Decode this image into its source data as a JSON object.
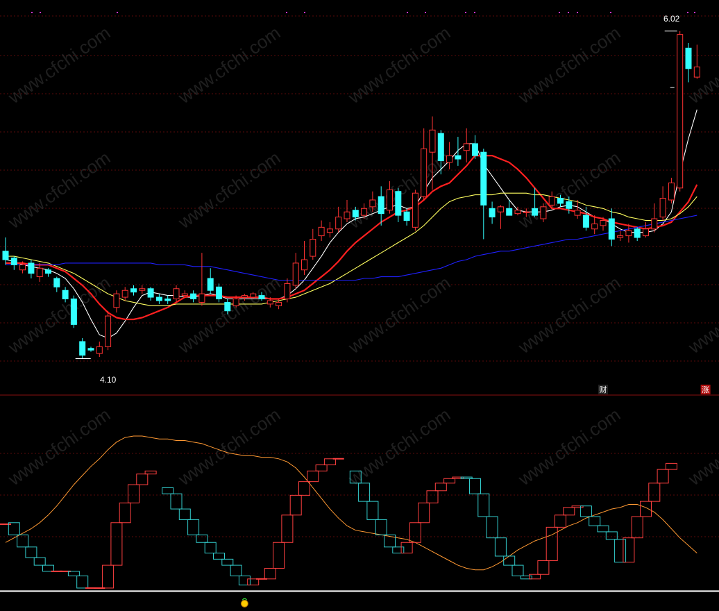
{
  "chart_data": [
    {
      "type": "candlestick",
      "name": "main",
      "price_labels": {
        "high": "6.02",
        "low": "4.10"
      },
      "ylim": [
        3.98,
        6.08
      ],
      "ohlc": [
        [
          4.73,
          4.68,
          4.81,
          4.65
        ],
        [
          4.69,
          4.65,
          4.7,
          4.62
        ],
        [
          4.62,
          4.65,
          4.67,
          4.6
        ],
        [
          4.66,
          4.6,
          4.68,
          4.57
        ],
        [
          4.58,
          4.63,
          4.66,
          4.55
        ],
        [
          4.62,
          4.6,
          4.63,
          4.58
        ],
        [
          4.57,
          4.52,
          4.58,
          4.49
        ],
        [
          4.5,
          4.45,
          4.52,
          4.43
        ],
        [
          4.45,
          4.3,
          4.47,
          4.28
        ],
        [
          4.2,
          4.12,
          4.22,
          4.1
        ],
        [
          4.16,
          4.15,
          4.17,
          4.14
        ],
        [
          4.13,
          4.17,
          4.2,
          4.11
        ],
        [
          4.17,
          4.35,
          4.38,
          4.15
        ],
        [
          4.4,
          4.48,
          4.5,
          4.37
        ],
        [
          4.46,
          4.5,
          4.52,
          4.44
        ],
        [
          4.51,
          4.49,
          4.53,
          4.47
        ],
        [
          4.5,
          4.51,
          4.53,
          4.48
        ],
        [
          4.51,
          4.46,
          4.52,
          4.44
        ],
        [
          4.46,
          4.44,
          4.48,
          4.42
        ],
        [
          4.45,
          4.44,
          4.47,
          4.42
        ],
        [
          4.45,
          4.51,
          4.53,
          4.43
        ],
        [
          4.47,
          4.48,
          4.5,
          4.46
        ],
        [
          4.48,
          4.45,
          4.5,
          4.43
        ],
        [
          4.43,
          4.48,
          4.72,
          4.41
        ],
        [
          4.57,
          4.5,
          4.63,
          4.48
        ],
        [
          4.52,
          4.45,
          4.54,
          4.43
        ],
        [
          4.43,
          4.38,
          4.45,
          4.36
        ],
        [
          4.41,
          4.45,
          4.47,
          4.4
        ],
        [
          4.46,
          4.47,
          4.48,
          4.44
        ],
        [
          4.46,
          4.48,
          4.49,
          4.45
        ],
        [
          4.47,
          4.45,
          4.49,
          4.44
        ],
        [
          4.42,
          4.44,
          4.46,
          4.4
        ],
        [
          4.41,
          4.43,
          4.45,
          4.39
        ],
        [
          4.45,
          4.54,
          4.57,
          4.43
        ],
        [
          4.53,
          4.66,
          4.72,
          4.51
        ],
        [
          4.62,
          4.68,
          4.79,
          4.59
        ],
        [
          4.7,
          4.8,
          4.86,
          4.68
        ],
        [
          4.82,
          4.87,
          4.91,
          4.79
        ],
        [
          4.84,
          4.86,
          4.9,
          4.81
        ],
        [
          4.86,
          4.93,
          4.99,
          4.84
        ],
        [
          4.92,
          4.96,
          5.03,
          4.9
        ],
        [
          4.97,
          4.93,
          4.99,
          4.91
        ],
        [
          4.94,
          4.98,
          5.01,
          4.92
        ],
        [
          4.99,
          5.03,
          5.08,
          4.96
        ],
        [
          5.05,
          4.95,
          5.11,
          4.88
        ],
        [
          4.97,
          5.09,
          5.14,
          4.95
        ],
        [
          5.08,
          4.94,
          5.1,
          4.9
        ],
        [
          4.96,
          4.91,
          4.98,
          4.88
        ],
        [
          4.87,
          5.07,
          5.09,
          4.85
        ],
        [
          5.05,
          5.33,
          5.45,
          5.03
        ],
        [
          5.31,
          5.44,
          5.52,
          5.09
        ],
        [
          5.42,
          5.26,
          5.44,
          5.18
        ],
        [
          5.25,
          5.29,
          5.37,
          5.21
        ],
        [
          5.29,
          5.27,
          5.4,
          5.23
        ],
        [
          5.32,
          5.36,
          5.45,
          5.25
        ],
        [
          5.36,
          5.29,
          5.41,
          5.27
        ],
        [
          5.31,
          5.0,
          5.33,
          4.8
        ],
        [
          4.98,
          4.93,
          5.02,
          4.89
        ],
        [
          4.96,
          4.99,
          5.0,
          4.86
        ],
        [
          4.98,
          4.94,
          5.03,
          4.94
        ],
        [
          4.95,
          4.97,
          4.99,
          4.94
        ],
        [
          4.96,
          4.96,
          4.98,
          4.93
        ],
        [
          4.98,
          4.94,
          5.1,
          4.93
        ],
        [
          4.92,
          4.99,
          5.01,
          4.9
        ],
        [
          5.0,
          5.05,
          5.08,
          4.98
        ],
        [
          5.04,
          5.01,
          5.06,
          4.99
        ],
        [
          5.02,
          4.98,
          5.05,
          4.95
        ],
        [
          4.94,
          4.97,
          5.03,
          4.92
        ],
        [
          4.94,
          4.87,
          4.99,
          4.85
        ],
        [
          4.86,
          4.89,
          4.94,
          4.83
        ],
        [
          4.88,
          4.91,
          4.93,
          4.85
        ],
        [
          4.92,
          4.8,
          4.98,
          4.76
        ],
        [
          4.81,
          4.82,
          4.85,
          4.79
        ],
        [
          4.82,
          4.85,
          4.89,
          4.78
        ],
        [
          4.86,
          4.81,
          4.87,
          4.79
        ],
        [
          4.82,
          4.86,
          4.9,
          4.81
        ],
        [
          4.86,
          4.92,
          5.01,
          4.84
        ],
        [
          4.93,
          5.04,
          5.11,
          4.91
        ],
        [
          5.03,
          5.13,
          5.16,
          5.01
        ],
        [
          5.1,
          6.0,
          6.02,
          5.08
        ],
        [
          5.92,
          5.8,
          5.95,
          5.72
        ],
        [
          5.75,
          5.81,
          5.94,
          5.74
        ]
      ],
      "ma_lines": [
        {
          "name": "MA5",
          "color": "#ffffff",
          "values": [
            4.68,
            4.67,
            4.65,
            4.64,
            4.63,
            4.62,
            4.6,
            4.57,
            4.51,
            4.43,
            4.33,
            4.24,
            4.22,
            4.25,
            4.32,
            4.4,
            4.47,
            4.49,
            4.48,
            4.47,
            4.47,
            4.46,
            4.46,
            4.47,
            4.48,
            4.47,
            4.45,
            4.45,
            4.45,
            4.45,
            4.45,
            4.45,
            4.45,
            4.47,
            4.51,
            4.56,
            4.63,
            4.7,
            4.78,
            4.84,
            4.89,
            4.92,
            4.93,
            4.95,
            4.97,
            4.99,
            5.0,
            4.98,
            4.99,
            5.08,
            5.16,
            5.21,
            5.26,
            5.32,
            5.36,
            5.36,
            5.24,
            5.17,
            5.1,
            5.03,
            4.97,
            4.96,
            4.96,
            4.96,
            4.97,
            4.99,
            5.0,
            4.99,
            4.96,
            4.93,
            4.92,
            4.89,
            4.86,
            4.84,
            4.84,
            4.84,
            4.85,
            4.89,
            4.96,
            5.19,
            5.39,
            5.56
          ]
        },
        {
          "name": "MA10",
          "color": "#ff2020",
          "values": [
            4.66,
            4.66,
            4.66,
            4.65,
            4.65,
            4.65,
            4.63,
            4.61,
            4.57,
            4.53,
            4.48,
            4.42,
            4.37,
            4.34,
            4.33,
            4.33,
            4.34,
            4.36,
            4.38,
            4.4,
            4.43,
            4.46,
            4.47,
            4.47,
            4.47,
            4.47,
            4.46,
            4.46,
            4.46,
            4.46,
            4.46,
            4.45,
            4.45,
            4.46,
            4.48,
            4.5,
            4.54,
            4.58,
            4.62,
            4.67,
            4.73,
            4.78,
            4.82,
            4.86,
            4.9,
            4.93,
            4.96,
            4.97,
            4.99,
            5.03,
            5.08,
            5.11,
            5.13,
            5.18,
            5.23,
            5.29,
            5.29,
            5.29,
            5.27,
            5.25,
            5.21,
            5.16,
            5.1,
            5.04,
            4.98,
            4.98,
            4.97,
            4.96,
            4.95,
            4.93,
            4.92,
            4.9,
            4.89,
            4.88,
            4.87,
            4.86,
            4.87,
            4.88,
            4.9,
            4.96,
            5.02,
            5.12
          ]
        },
        {
          "name": "MA20",
          "color": "#ffff60",
          "values": [
            4.7,
            4.7,
            4.69,
            4.68,
            4.67,
            4.66,
            4.64,
            4.62,
            4.6,
            4.57,
            4.54,
            4.51,
            4.48,
            4.46,
            4.44,
            4.43,
            4.42,
            4.41,
            4.41,
            4.41,
            4.42,
            4.42,
            4.42,
            4.42,
            4.42,
            4.42,
            4.42,
            4.42,
            4.42,
            4.42,
            4.42,
            4.43,
            4.44,
            4.45,
            4.46,
            4.48,
            4.5,
            4.52,
            4.54,
            4.57,
            4.6,
            4.63,
            4.66,
            4.69,
            4.72,
            4.75,
            4.78,
            4.81,
            4.84,
            4.88,
            4.93,
            4.98,
            5.02,
            5.04,
            5.05,
            5.06,
            5.06,
            5.06,
            5.07,
            5.07,
            5.07,
            5.07,
            5.06,
            5.06,
            5.05,
            5.04,
            5.03,
            5.02,
            5.0,
            4.99,
            4.98,
            4.96,
            4.95,
            4.93,
            4.92,
            4.91,
            4.91,
            4.91,
            4.92,
            4.95,
            4.99,
            5.05
          ]
        },
        {
          "name": "MA60",
          "color": "#2020ff",
          "values": [
            4.65,
            4.65,
            4.65,
            4.65,
            4.65,
            4.65,
            4.65,
            4.66,
            4.66,
            4.66,
            4.66,
            4.66,
            4.66,
            4.66,
            4.66,
            4.66,
            4.66,
            4.66,
            4.65,
            4.65,
            4.65,
            4.65,
            4.64,
            4.64,
            4.64,
            4.63,
            4.62,
            4.61,
            4.6,
            4.59,
            4.58,
            4.57,
            4.56,
            4.56,
            4.56,
            4.56,
            4.56,
            4.56,
            4.56,
            4.56,
            4.56,
            4.56,
            4.57,
            4.57,
            4.58,
            4.58,
            4.58,
            4.59,
            4.6,
            4.61,
            4.62,
            4.63,
            4.65,
            4.67,
            4.68,
            4.7,
            4.71,
            4.72,
            4.73,
            4.73,
            4.74,
            4.75,
            4.76,
            4.77,
            4.78,
            4.79,
            4.8,
            4.8,
            4.81,
            4.82,
            4.83,
            4.84,
            4.85,
            4.86,
            4.87,
            4.88,
            4.89,
            4.9,
            4.91,
            4.92,
            4.93,
            4.94
          ]
        }
      ],
      "markers": [
        {
          "text": "财",
          "bar_index": 70,
          "color": "#202020"
        },
        {
          "text": "涨",
          "bar_index": 82,
          "color": "#b01010"
        }
      ]
    },
    {
      "type": "indicator",
      "name": "lower",
      "ylim": [
        0,
        100
      ],
      "line_color": "#ff9933",
      "line": [
        25,
        28,
        31,
        34,
        38,
        43,
        49,
        56,
        63,
        69,
        75,
        80,
        86,
        91,
        94,
        95,
        95,
        94,
        93,
        93,
        92,
        92,
        91,
        90,
        88,
        86,
        84,
        83,
        82,
        82,
        81,
        81,
        80,
        78,
        74,
        68,
        61,
        54,
        47,
        41,
        36,
        33,
        32,
        31,
        30,
        29,
        28,
        27,
        25,
        22,
        19,
        16,
        13,
        10,
        8,
        7,
        7,
        9,
        12,
        16,
        20,
        23,
        26,
        28,
        30,
        33,
        36,
        38,
        41,
        43,
        45,
        47,
        48,
        50,
        50,
        48,
        45,
        40,
        34,
        28,
        23,
        18
      ],
      "boxes": [
        [
          null,
          37
        ],
        [
          38,
          30
        ],
        [
          30,
          22
        ],
        [
          22,
          15
        ],
        [
          15,
          10
        ],
        [
          10,
          6
        ],
        [
          6,
          6
        ],
        [
          6,
          6
        ],
        [
          6,
          3
        ],
        [
          3,
          -5
        ],
        [
          -5,
          -5
        ],
        [
          -5,
          -5
        ],
        [
          -5,
          10
        ],
        [
          10,
          38
        ],
        [
          38,
          51
        ],
        [
          51,
          63
        ],
        [
          63,
          70
        ],
        [
          70,
          72
        ],
        [
          null,
          null
        ],
        [
          61,
          57
        ],
        [
          57,
          47
        ],
        [
          47,
          40
        ],
        [
          40,
          30
        ],
        [
          30,
          25
        ],
        [
          25,
          18
        ],
        [
          18,
          14
        ],
        [
          14,
          10
        ],
        [
          10,
          3
        ],
        [
          3,
          -3
        ],
        [
          -3,
          1
        ],
        [
          1,
          1
        ],
        [
          1,
          8
        ],
        [
          8,
          25
        ],
        [
          25,
          43
        ],
        [
          43,
          56
        ],
        [
          56,
          65
        ],
        [
          65,
          72
        ],
        [
          72,
          76
        ],
        [
          76,
          80
        ],
        [
          80,
          80
        ],
        [
          null,
          null
        ],
        [
          72,
          64
        ],
        [
          64,
          52
        ],
        [
          52,
          40
        ],
        [
          40,
          30
        ],
        [
          30,
          22
        ],
        [
          22,
          18
        ],
        [
          18,
          25
        ],
        [
          25,
          38
        ],
        [
          38,
          51
        ],
        [
          51,
          59
        ],
        [
          59,
          64
        ],
        [
          64,
          67
        ],
        [
          67,
          68
        ],
        [
          68,
          67
        ],
        [
          67,
          57
        ],
        [
          57,
          42
        ],
        [
          42,
          28
        ],
        [
          28,
          16
        ],
        [
          16,
          10
        ],
        [
          10,
          3
        ],
        [
          3,
          1
        ],
        [
          1,
          4
        ],
        [
          4,
          13
        ],
        [
          13,
          35
        ],
        [
          35,
          43
        ],
        [
          43,
          48
        ],
        [
          48,
          49
        ],
        [
          49,
          42
        ],
        [
          42,
          36
        ],
        [
          36,
          32
        ],
        [
          32,
          27
        ],
        [
          27,
          12
        ],
        [
          12,
          28
        ],
        [
          28,
          42
        ],
        [
          42,
          52
        ],
        [
          52,
          64
        ],
        [
          64,
          73
        ],
        [
          73,
          77
        ]
      ],
      "reference_lines": [
        -7,
        -30
      ],
      "coin_bar_indices": [
        10,
        28
      ]
    }
  ]
}
